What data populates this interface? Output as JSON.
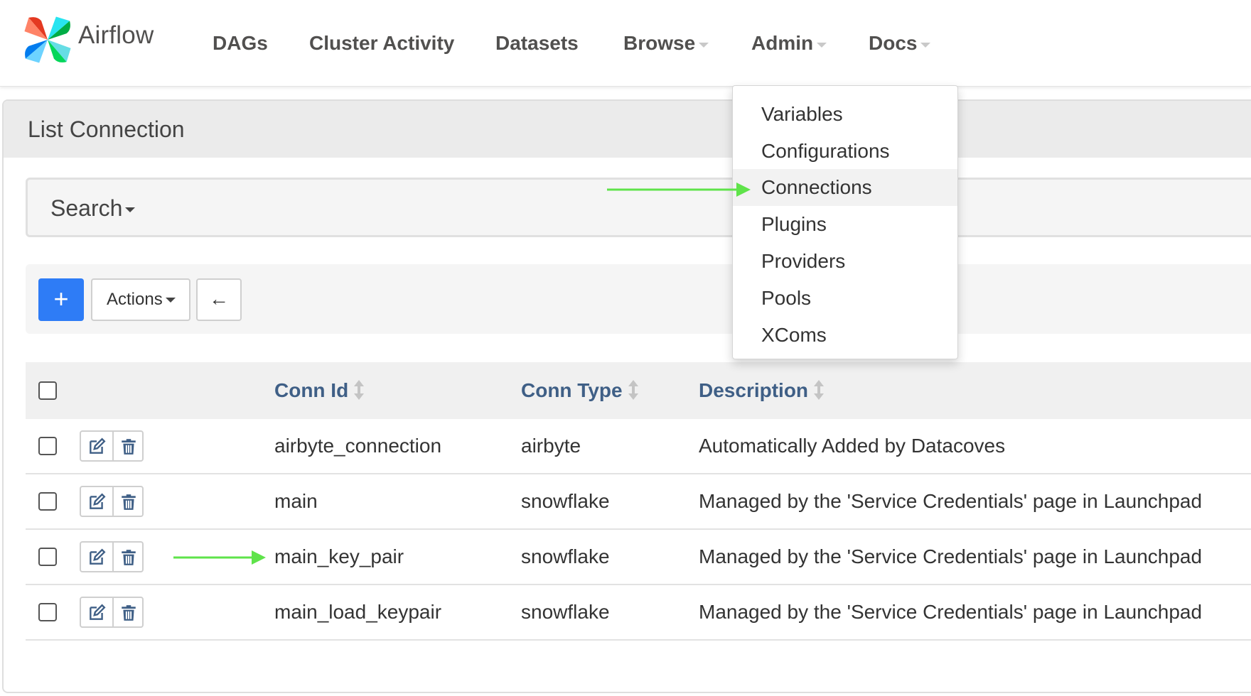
{
  "brand": {
    "name": "Airflow"
  },
  "nav": {
    "items": [
      {
        "label": "DAGs"
      },
      {
        "label": "Cluster Activity"
      },
      {
        "label": "Datasets"
      },
      {
        "label": "Browse"
      },
      {
        "label": "Admin"
      },
      {
        "label": "Docs"
      }
    ]
  },
  "admin_menu": {
    "items": [
      {
        "label": "Variables"
      },
      {
        "label": "Configurations"
      },
      {
        "label": "Connections"
      },
      {
        "label": "Plugins"
      },
      {
        "label": "Providers"
      },
      {
        "label": "Pools"
      },
      {
        "label": "XComs"
      }
    ],
    "highlighted": "Connections"
  },
  "page": {
    "title": "List Connection"
  },
  "search": {
    "label": "Search"
  },
  "toolbar": {
    "add_label": "+",
    "actions_label": "Actions",
    "back_label": "←"
  },
  "table": {
    "columns": [
      "Conn Id",
      "Conn Type",
      "Description"
    ],
    "rows": [
      {
        "conn_id": "airbyte_connection",
        "conn_type": "airbyte",
        "description": "Automatically Added by Datacoves"
      },
      {
        "conn_id": "main",
        "conn_type": "snowflake",
        "description": "Managed by the 'Service Credentials' page in Launchpad"
      },
      {
        "conn_id": "main_key_pair",
        "conn_type": "snowflake",
        "description": "Managed by the 'Service Credentials' page in Launchpad"
      },
      {
        "conn_id": "main_load_keypair",
        "conn_type": "snowflake",
        "description": "Managed by the 'Service Credentials' page in Launchpad"
      }
    ]
  },
  "colors": {
    "primary": "#2e7cf6",
    "header_link": "#3f5f86",
    "annotation_arrow": "#5fe34a"
  }
}
